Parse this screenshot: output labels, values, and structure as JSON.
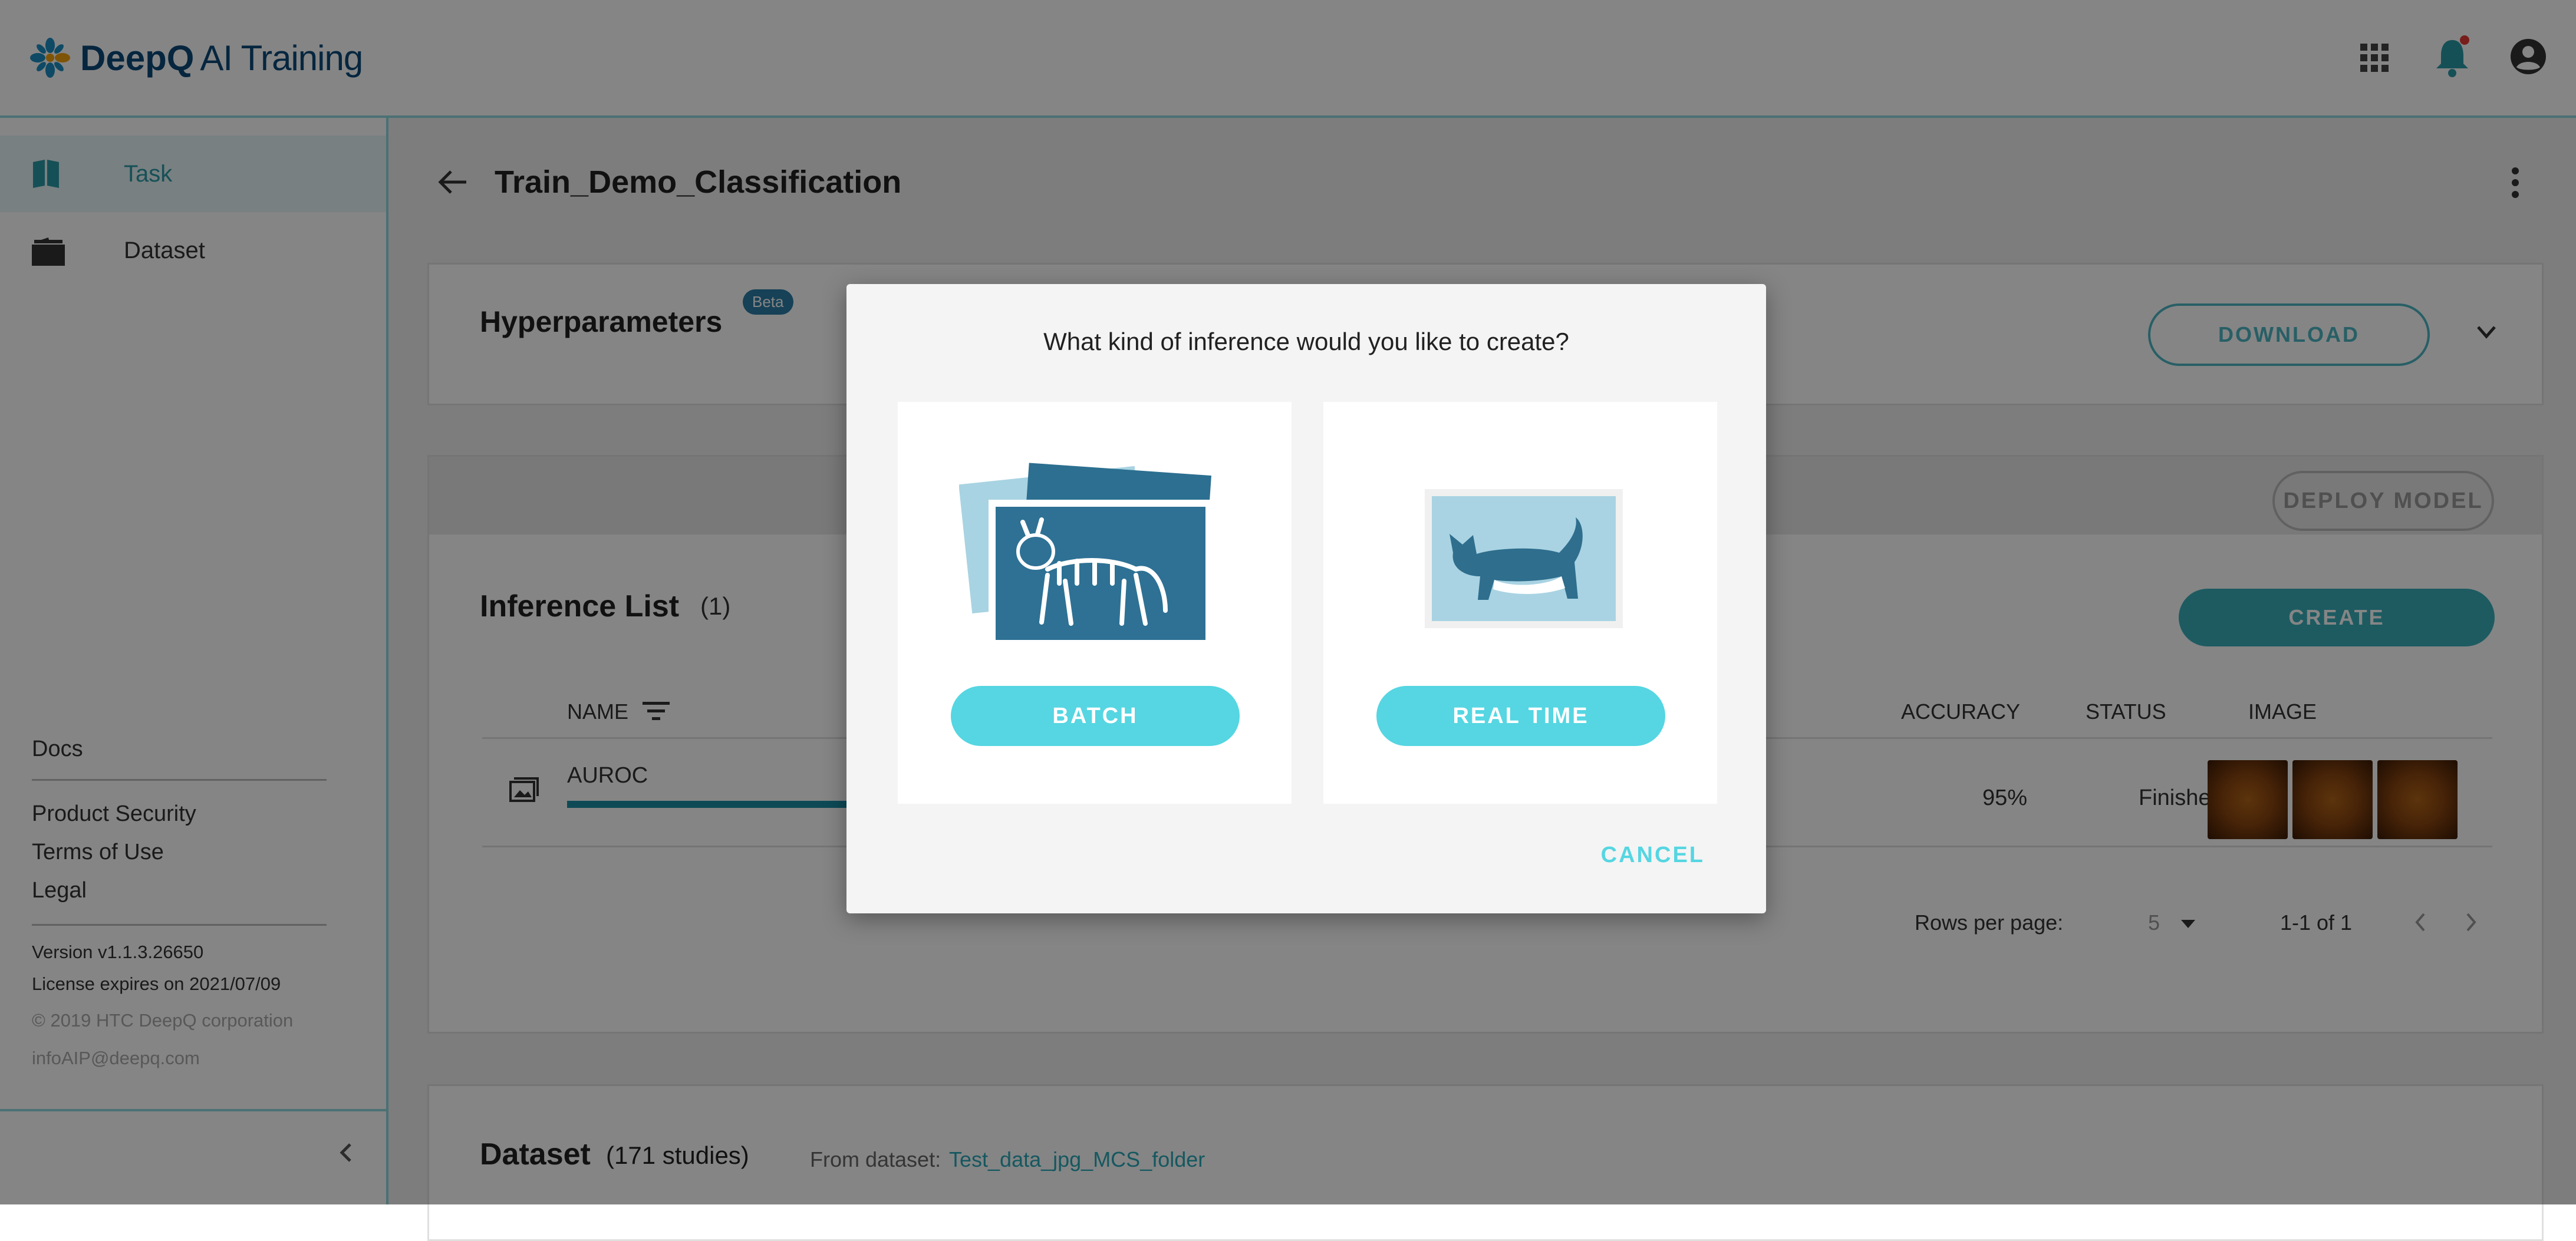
{
  "app": {
    "logo_bold": "DeepQ",
    "logo_rest": "AI Training"
  },
  "sidebar": {
    "items": [
      {
        "label": "Task",
        "icon": "book-icon"
      },
      {
        "label": "Dataset",
        "icon": "folder-icon"
      }
    ],
    "links": [
      "Docs",
      "Product Security",
      "Terms of Use",
      "Legal"
    ],
    "version": "Version v1.1.3.26650",
    "license": "License expires on 2021/07/09",
    "copyright": "© 2019 HTC DeepQ corporation",
    "email": "infoAIP@deepq.com"
  },
  "page": {
    "title": "Train_Demo_Classification"
  },
  "hyperparameters": {
    "title": "Hyperparameters",
    "badge": "Beta",
    "download_label": "DOWNLOAD"
  },
  "deploy": {
    "label": "DEPLOY MODEL"
  },
  "inference": {
    "title": "Inference List",
    "count": "(1)",
    "create_label": "CREATE",
    "columns": {
      "name": "NAME",
      "accuracy": "ACCURACY",
      "status": "STATUS",
      "image": "IMAGE"
    },
    "rows": [
      {
        "name": "AUROC",
        "accuracy": "95%",
        "status": "Finished",
        "progress": 1.0
      }
    ],
    "pagination": {
      "rows_label": "Rows per page:",
      "rows_value": "5",
      "range": "1-1 of 1"
    }
  },
  "dataset": {
    "title": "Dataset",
    "count": "(171 studies)",
    "from_label": "From dataset:",
    "link": "Test_data_jpg_MCS_folder"
  },
  "dialog": {
    "question": "What kind of inference would you like to create?",
    "batch_label": "BATCH",
    "realtime_label": "REAL TIME",
    "cancel_label": "CANCEL"
  },
  "colors": {
    "accent": "#38aebb",
    "dialog_button": "#55d6e2",
    "brand": "#0d4a7a",
    "notification_dot": "#e53935"
  }
}
